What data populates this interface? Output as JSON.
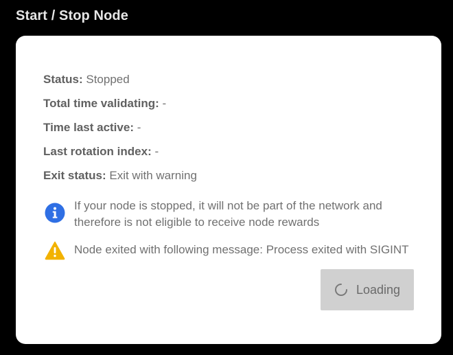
{
  "header": {
    "title": "Start / Stop Node"
  },
  "status": {
    "items": [
      {
        "label": "Status:",
        "value": "Stopped"
      },
      {
        "label": "Total time validating:",
        "value": "-"
      },
      {
        "label": "Time last active:",
        "value": "-"
      },
      {
        "label": "Last rotation index:",
        "value": "-"
      },
      {
        "label": "Exit status:",
        "value": "Exit with warning"
      }
    ]
  },
  "notices": {
    "info": {
      "icon": "info-icon",
      "text": "If your node is stopped, it will not be part of the network and therefore is not eligible to receive node rewards"
    },
    "warning": {
      "icon": "warning-icon",
      "text": "Node exited with following message: Process exited with SIGINT"
    }
  },
  "action": {
    "button_label": "Loading",
    "icon": "spinner-icon"
  },
  "colors": {
    "background": "#000000",
    "card": "#ffffff",
    "info_blue": "#2f6fe4",
    "warning_yellow": "#f2b200",
    "button_bg": "#d0d0d0"
  }
}
